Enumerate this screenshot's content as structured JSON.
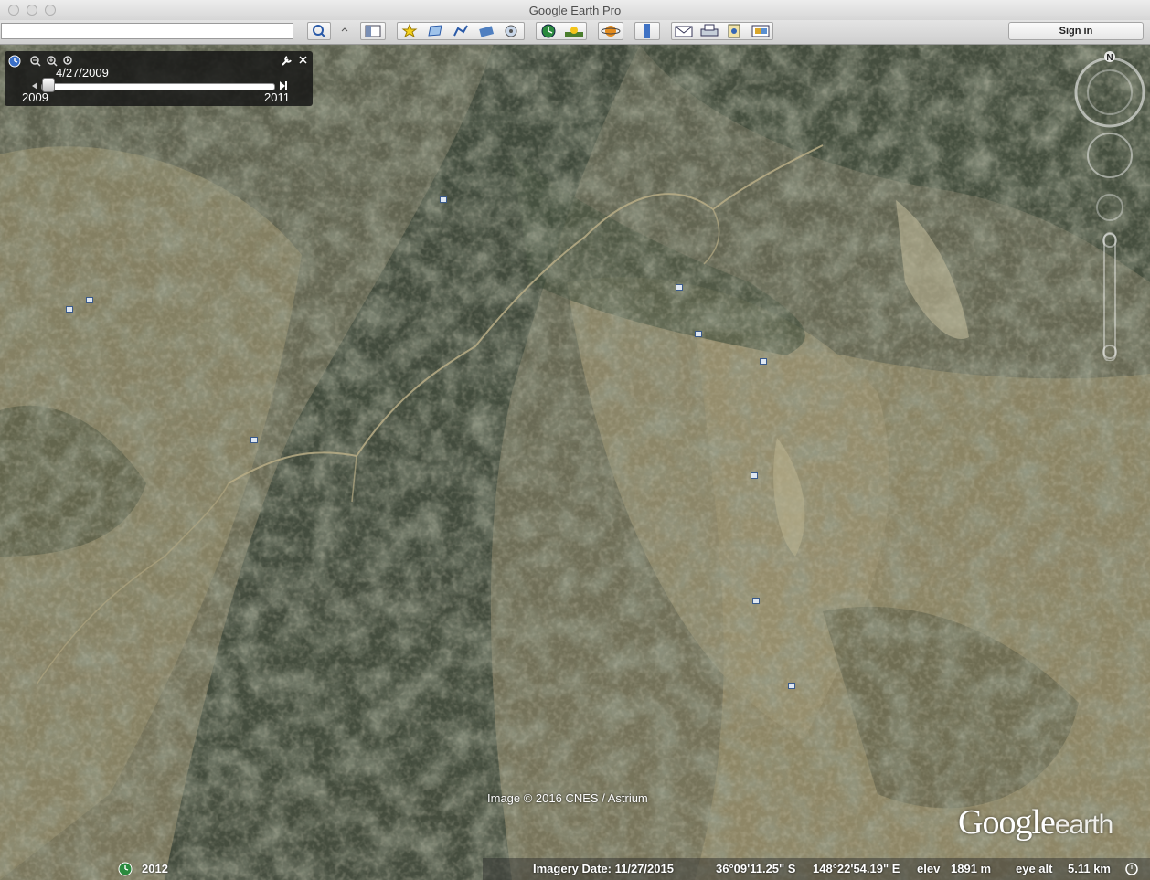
{
  "window": {
    "title": "Google Earth Pro"
  },
  "toolbar": {
    "search_value": "",
    "sign_in_label": "Sign in",
    "buttons": [
      "search-icon",
      "sidebar-icon",
      "add-placemark-icon",
      "add-polygon-icon",
      "add-path-icon",
      "image-overlay-icon",
      "record-tour-icon",
      "historical-imagery-icon",
      "sun-icon",
      "planets-icon",
      "ruler-icon",
      "email-icon",
      "print-icon",
      "save-image-icon",
      "view-in-maps-icon"
    ]
  },
  "time_slider": {
    "current_date": "4/27/2009",
    "start_year": "2009",
    "end_year": "2011"
  },
  "map": {
    "image_credit": "Image © 2016 CNES / Astrium",
    "logo_google": "Google",
    "logo_earth": "earth",
    "compass_north": "N"
  },
  "status": {
    "history_year": "2012",
    "imagery_date": "Imagery Date: 11/27/2015",
    "lat": "36°09'11.25\" S",
    "lon": "148°22'54.19\" E",
    "elev_label": "elev",
    "elev_value": "1891 m",
    "eye_alt_label": "eye alt",
    "eye_alt_value": "5.11 km"
  },
  "colors": {
    "terrain_base": "#6f6e55",
    "terrain_dark": "#3f4a3a",
    "terrain_light": "#a9a17c"
  }
}
